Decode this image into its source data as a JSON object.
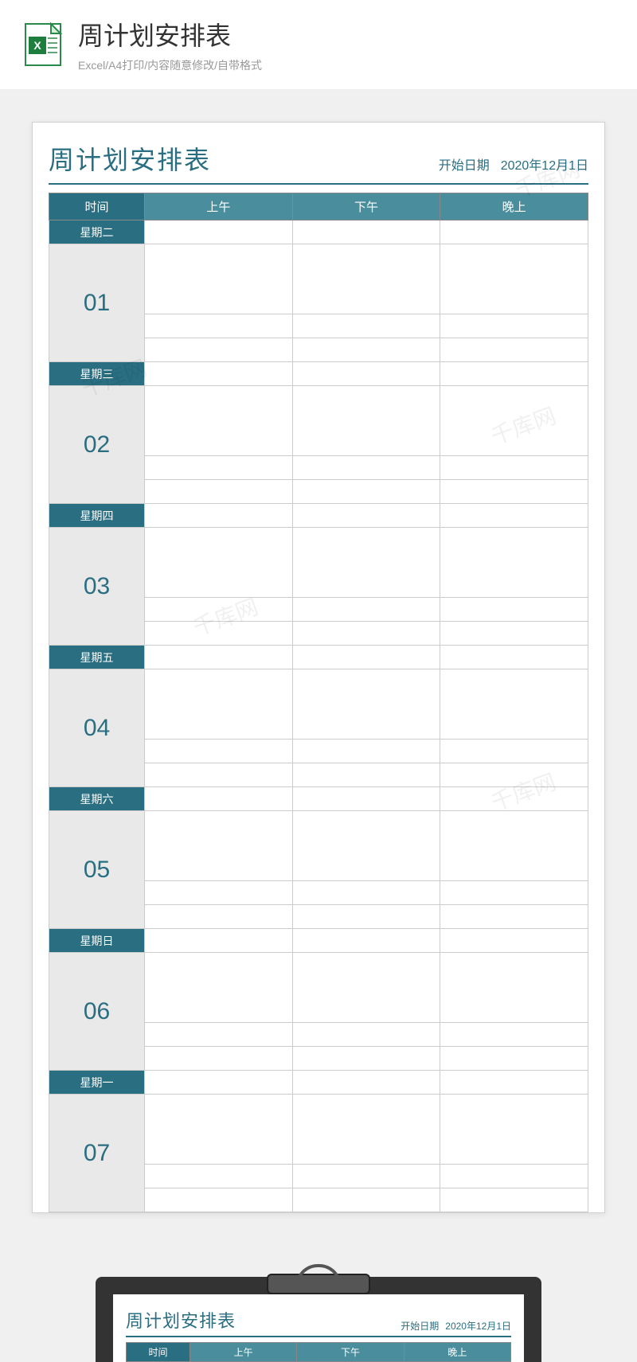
{
  "header": {
    "title": "周计划安排表",
    "subtitle": "Excel/A4打印/内容随意修改/自带格式"
  },
  "sheet": {
    "title": "周计划安排表",
    "start_date_label": "开始日期",
    "start_date_value": "2020年12月1日",
    "columns": {
      "c0": "时间",
      "c1": "上午",
      "c2": "下午",
      "c3": "晚上"
    },
    "days": [
      {
        "weekday": "星期二",
        "num": "01"
      },
      {
        "weekday": "星期三",
        "num": "02"
      },
      {
        "weekday": "星期四",
        "num": "03"
      },
      {
        "weekday": "星期五",
        "num": "04"
      },
      {
        "weekday": "星期六",
        "num": "05"
      },
      {
        "weekday": "星期日",
        "num": "06"
      },
      {
        "weekday": "星期一",
        "num": "07"
      }
    ]
  },
  "watermark": "千库网",
  "clipboard": {
    "title": "周计划安排表",
    "start_date_label": "开始日期",
    "start_date_value": "2020年12月1日",
    "columns": {
      "c0": "时间",
      "c1": "上午",
      "c2": "下午",
      "c3": "晚上"
    }
  }
}
